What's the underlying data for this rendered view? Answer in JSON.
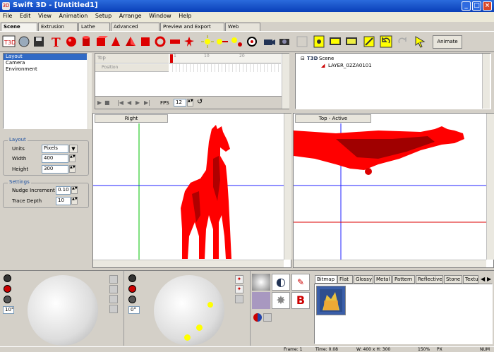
{
  "window": {
    "title": "Swift 3D - [Untitled1]"
  },
  "menu": [
    "File",
    "Edit",
    "View",
    "Animation",
    "Setup",
    "Arrange",
    "Window",
    "Help"
  ],
  "editor_tabs": [
    "Scene Editor",
    "Extrusion Editor",
    "Lathe Editor",
    "Advanced Modeler",
    "Preview and Export Editor",
    "Web Assistant"
  ],
  "toolbar": {
    "animate_label": "Animate"
  },
  "object_list": [
    "Layout",
    "Camera",
    "Environment"
  ],
  "timeline": {
    "track_top": "Top",
    "track_position": "Position",
    "ruler": [
      "1",
      "10",
      "20"
    ],
    "fps_label": "FPS",
    "fps_value": "12"
  },
  "scene_tree": {
    "root": "Scene",
    "child": "LAYER_02ZA0101"
  },
  "properties": {
    "layout_group": "Layout",
    "units_label": "Units",
    "units_value": "Pixels",
    "width_label": "Width",
    "width_value": "400",
    "height_label": "Height",
    "height_value": "300",
    "settings_group": "Settings",
    "nudge_label": "Nudge Increment",
    "nudge_value": "0.10",
    "trace_label": "Trace Depth",
    "trace_value": "10"
  },
  "viewports": {
    "left_title": "Right",
    "right_title": "Top - Active"
  },
  "lighting": {
    "left_angle": "10°",
    "right_angle": "0°"
  },
  "material_tabs": [
    "Bitmap",
    "Flat",
    "Glossy",
    "Metal",
    "Pattern",
    "Reflective",
    "Stone",
    "Textu"
  ],
  "status": {
    "frame": "Frame: 1",
    "time": "Time: 0.08",
    "size": "W: 400 x H: 300",
    "zoom": "150%",
    "mode": "PX",
    "extra": "NUM"
  },
  "colors": {
    "model": "#ff0000",
    "titlebar": "#0a3fb8",
    "axis_green": "#00c000",
    "axis_blue": "#2020ff"
  }
}
